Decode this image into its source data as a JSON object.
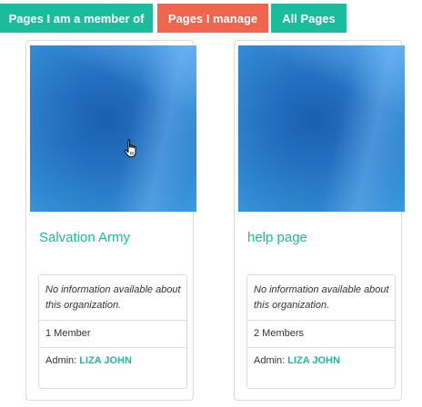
{
  "tabs": {
    "member": "Pages I am a member of",
    "manage": "Pages I manage",
    "all": "All Pages"
  },
  "cards": [
    {
      "title": "Salvation Army",
      "info": "No information available about this organization.",
      "members": "1 Member",
      "admin_label": "Admin: ",
      "admin_name": "LIZA JOHN"
    },
    {
      "title": "help page",
      "info": "No information available about this organization.",
      "members": "2 Members",
      "admin_label": "Admin: ",
      "admin_name": "LIZA JOHN"
    }
  ],
  "colors": {
    "teal": "#1abc9c",
    "coral": "#f0654e"
  },
  "icons": {
    "cursor": "hand-pointer-icon"
  }
}
